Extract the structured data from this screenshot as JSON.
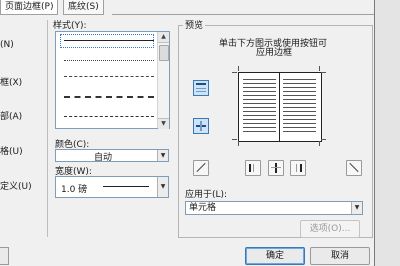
{
  "tabs": [
    {
      "label": "页面边框(P)"
    },
    {
      "label": "底纹(S)"
    }
  ],
  "left_labels": [
    "(N)",
    "框(X)",
    "部(A)",
    "格(U)",
    "定义(U)"
  ],
  "style_section": {
    "label": "样式(Y):"
  },
  "color": {
    "label": "颜色(C):",
    "value": "自动"
  },
  "width": {
    "label": "宽度(W):",
    "value": "1.0 磅"
  },
  "preview": {
    "label": "预览",
    "hint_line1": "单击下方图示或使用按钮可",
    "hint_line2": "应用边框"
  },
  "apply_to": {
    "label": "应用于(L):",
    "value": "单元格"
  },
  "buttons": {
    "options": "选项(O)...",
    "ok": "确定",
    "cancel": "取消"
  },
  "colors": {
    "dialog_bg": "#f0f0f0",
    "accent_blue": "#3a78b6",
    "field_border": "#7f9db9",
    "ok_highlight": "#6aa7e5"
  }
}
